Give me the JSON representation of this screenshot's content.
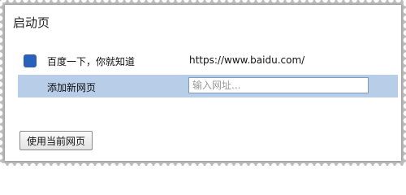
{
  "dialog": {
    "title": "启动页"
  },
  "pages": [
    {
      "title": "百度一下，你就知道",
      "url": "https://www.baidu.com/",
      "icon": "baidu-paw-icon"
    }
  ],
  "add_row": {
    "label": "添加新网页",
    "placeholder": "输入网址..."
  },
  "footer": {
    "use_current_label": "使用当前网页"
  },
  "colors": {
    "selected_row": "#b7cde8",
    "favicon_bg": "#2e5fb8"
  }
}
